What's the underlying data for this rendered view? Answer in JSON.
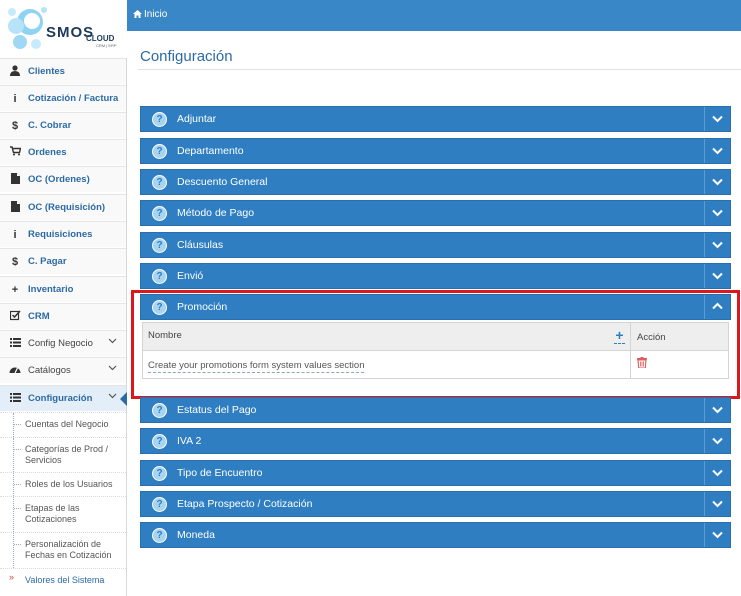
{
  "logo": {
    "word": "SMOS",
    "sub": "CLOUD",
    "tag": "CRM | ERP"
  },
  "breadcrumb": {
    "label": "Inicio"
  },
  "page_title": "Configuración",
  "sidebar": {
    "items": [
      {
        "label": "Clientes",
        "icon": "user-icon"
      },
      {
        "label": "Cotización / Factura",
        "icon": "info-icon"
      },
      {
        "label": "C. Cobrar",
        "icon": "dollar-icon"
      },
      {
        "label": "Ordenes",
        "icon": "cart-icon"
      },
      {
        "label": "OC (Ordenes)",
        "icon": "document-icon"
      },
      {
        "label": "OC (Requisición)",
        "icon": "document-icon"
      },
      {
        "label": "Requisiciones",
        "icon": "info-icon"
      },
      {
        "label": "C. Pagar",
        "icon": "dollar-icon"
      },
      {
        "label": "Inventario",
        "icon": "plus-icon"
      },
      {
        "label": "CRM",
        "icon": "checkbox-icon"
      },
      {
        "label": "Config Negocio",
        "icon": "list-icon"
      },
      {
        "label": "Catálogos",
        "icon": "dashboard-icon"
      },
      {
        "label": "Configuración",
        "icon": "list-icon"
      }
    ],
    "subitems": [
      {
        "label": "Cuentas del Negocio"
      },
      {
        "label": "Categorías de Prod / Servicios"
      },
      {
        "label": "Roles de los Usuarios"
      },
      {
        "label": "Etapas de las Cotizaciones"
      },
      {
        "label": "Personalización de Fechas en Cotización"
      },
      {
        "label": "Valores del Sistema"
      }
    ]
  },
  "sections": [
    {
      "label": "Adjuntar",
      "expanded": false
    },
    {
      "label": "Departamento",
      "expanded": false
    },
    {
      "label": "Descuento General",
      "expanded": false
    },
    {
      "label": "Método de Pago",
      "expanded": false
    },
    {
      "label": "Cláusulas",
      "expanded": false
    },
    {
      "label": "Envió",
      "expanded": false
    },
    {
      "label": "Promoción",
      "expanded": true
    },
    {
      "label": "Estatus del Pago",
      "expanded": false
    },
    {
      "label": "IVA 2",
      "expanded": false
    },
    {
      "label": "Tipo de Encuentro",
      "expanded": false
    },
    {
      "label": "Etapa Prospecto / Cotización",
      "expanded": false
    },
    {
      "label": "Moneda",
      "expanded": false
    }
  ],
  "promo_table": {
    "col_nombre": "Nombre",
    "col_accion": "Acción",
    "row_text": "Create your promotions form system values section"
  },
  "colors": {
    "accent": "#2f7ec2",
    "topbar": "#3a87c8",
    "highlight": "#d9191e"
  }
}
